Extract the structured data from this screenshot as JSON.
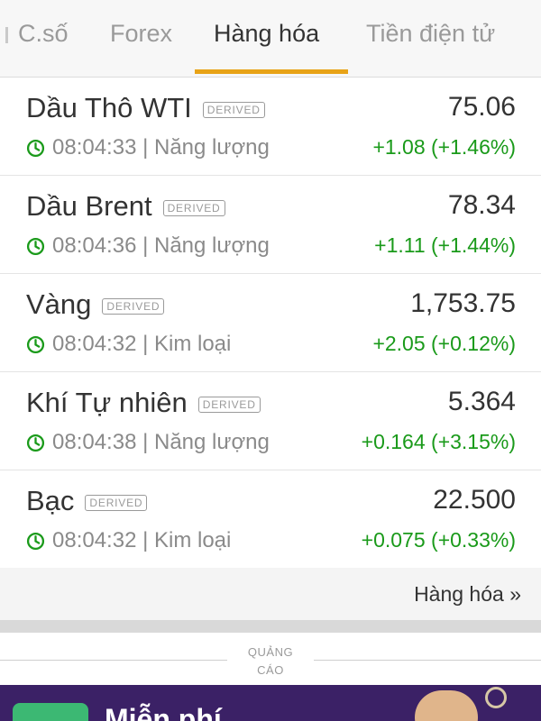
{
  "tabs": [
    {
      "label": "C.số",
      "active": false
    },
    {
      "label": "Forex",
      "active": false
    },
    {
      "label": "Hàng hóa",
      "active": true
    },
    {
      "label": "Tiền điện tử",
      "active": false
    }
  ],
  "badge_label": "DERIVED",
  "rows": [
    {
      "name": "Dầu Thô WTI",
      "price": "75.06",
      "time": "08:04:33",
      "category": "Năng lượng",
      "change": "+1.08 (+1.46%)"
    },
    {
      "name": "Dầu Brent",
      "price": "78.34",
      "time": "08:04:36",
      "category": "Năng lượng",
      "change": "+1.11 (+1.44%)"
    },
    {
      "name": "Vàng",
      "price": "1,753.75",
      "time": "08:04:32",
      "category": "Kim loại",
      "change": "+2.05 (+0.12%)"
    },
    {
      "name": "Khí Tự nhiên",
      "price": "5.364",
      "time": "08:04:38",
      "category": "Năng lượng",
      "change": "+0.164 (+3.15%)"
    },
    {
      "name": "Bạc",
      "price": "22.500",
      "time": "08:04:32",
      "category": "Kim loại",
      "change": "+0.075 (+0.33%)"
    }
  ],
  "more_link": "Hàng hóa »",
  "ad": {
    "label_line1": "QUẢNG",
    "label_line2": "CÁO",
    "headline": "Miễn phí"
  },
  "colors": {
    "accent": "#e8a317",
    "positive": "#1a9a1a",
    "ad_background": "#3b2166"
  }
}
